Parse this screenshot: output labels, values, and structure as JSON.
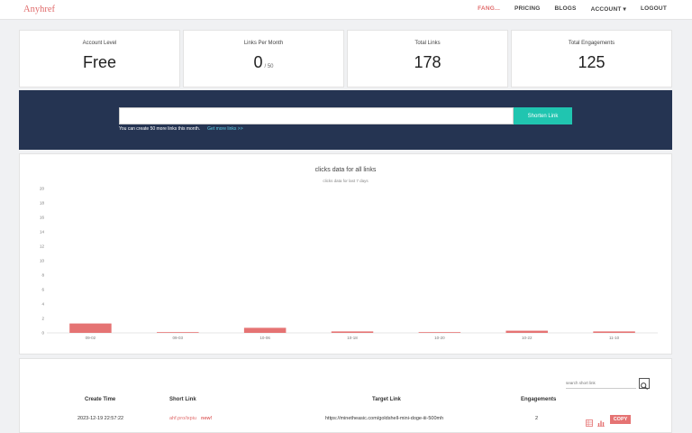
{
  "nav": {
    "brand": "Anyhref",
    "items": [
      "FANG...",
      "PRICING",
      "BLOGS",
      "ACCOUNT ▾",
      "LOGOUT"
    ]
  },
  "stats": [
    {
      "label": "Account Level",
      "value": "Free",
      "suffix": ""
    },
    {
      "label": "Links Per Month",
      "value": "0",
      "suffix": "/ 50"
    },
    {
      "label": "Total Links",
      "value": "178",
      "suffix": ""
    },
    {
      "label": "Total Engagements",
      "value": "125",
      "suffix": ""
    }
  ],
  "banner": {
    "input_value": "",
    "button_label": "Shorten Link",
    "note": "You can create 50 more links this month.",
    "more_link": "Get more links >>"
  },
  "chart_data": {
    "type": "bar",
    "title": "clicks data for all links",
    "subtitle": "clicks data for last 7 days",
    "categories": [
      "09-02",
      "09-03",
      "10-06",
      "10-18",
      "10-20",
      "10-22",
      "11-10"
    ],
    "values": [
      1.3,
      0.1,
      0.7,
      0.2,
      0.1,
      0.3,
      0.2
    ],
    "ylim": [
      0,
      20
    ],
    "yticks": [
      0,
      2,
      4,
      6,
      8,
      10,
      12,
      14,
      16,
      18,
      20
    ],
    "color": "#e57373"
  },
  "table": {
    "search_placeholder": "search short link",
    "headers": [
      "Create Time",
      "Short Link",
      "Target Link",
      "Engagements"
    ],
    "rows": [
      {
        "create_time": "2023-12-19 22:57:22",
        "short_link": "ahf.pro/ixpiu",
        "new_badge": "new!",
        "target_link": "https://minetheasic.com/goldshell-mini-doge-iii-500mh",
        "engagements": "2",
        "copy_label": "COPY"
      }
    ]
  }
}
